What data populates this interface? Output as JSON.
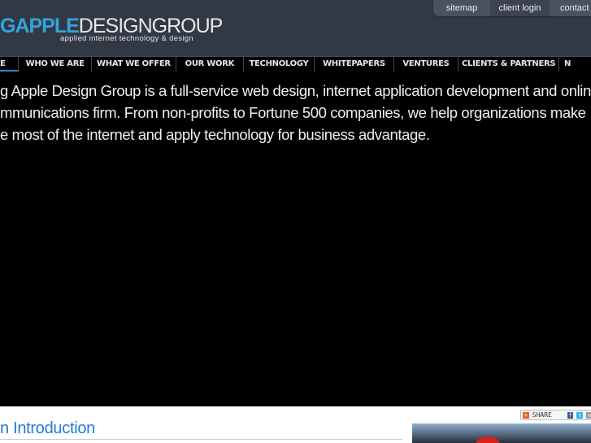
{
  "header": {
    "logo_bold": "GAPPLE",
    "logo_light": "DESIGNGROUP",
    "tagline": "applied internet technology & design",
    "top_links": [
      "sitemap",
      "client login",
      "contact u"
    ]
  },
  "nav": {
    "items": [
      "E",
      "WHO WE ARE",
      "WHAT WE OFFER",
      "OUR WORK",
      "TECHNOLOGY",
      "WHITEPAPERS",
      "VENTURES",
      "CLIENTS & PARTNERS",
      "N"
    ]
  },
  "intro": {
    "lines": [
      "g Apple Design Group is a full-service web design, internet application development and onlin",
      "mmunications firm. From non-profits to Fortune 500 companies, we help organizations make",
      "e most of the internet and apply technology for business advantage."
    ]
  },
  "section": {
    "heading": "n Introduction"
  },
  "share": {
    "label": "SHARE"
  },
  "colors": {
    "header_bg": "#323945",
    "accent": "#35a3dd",
    "heading": "#2579d2"
  }
}
